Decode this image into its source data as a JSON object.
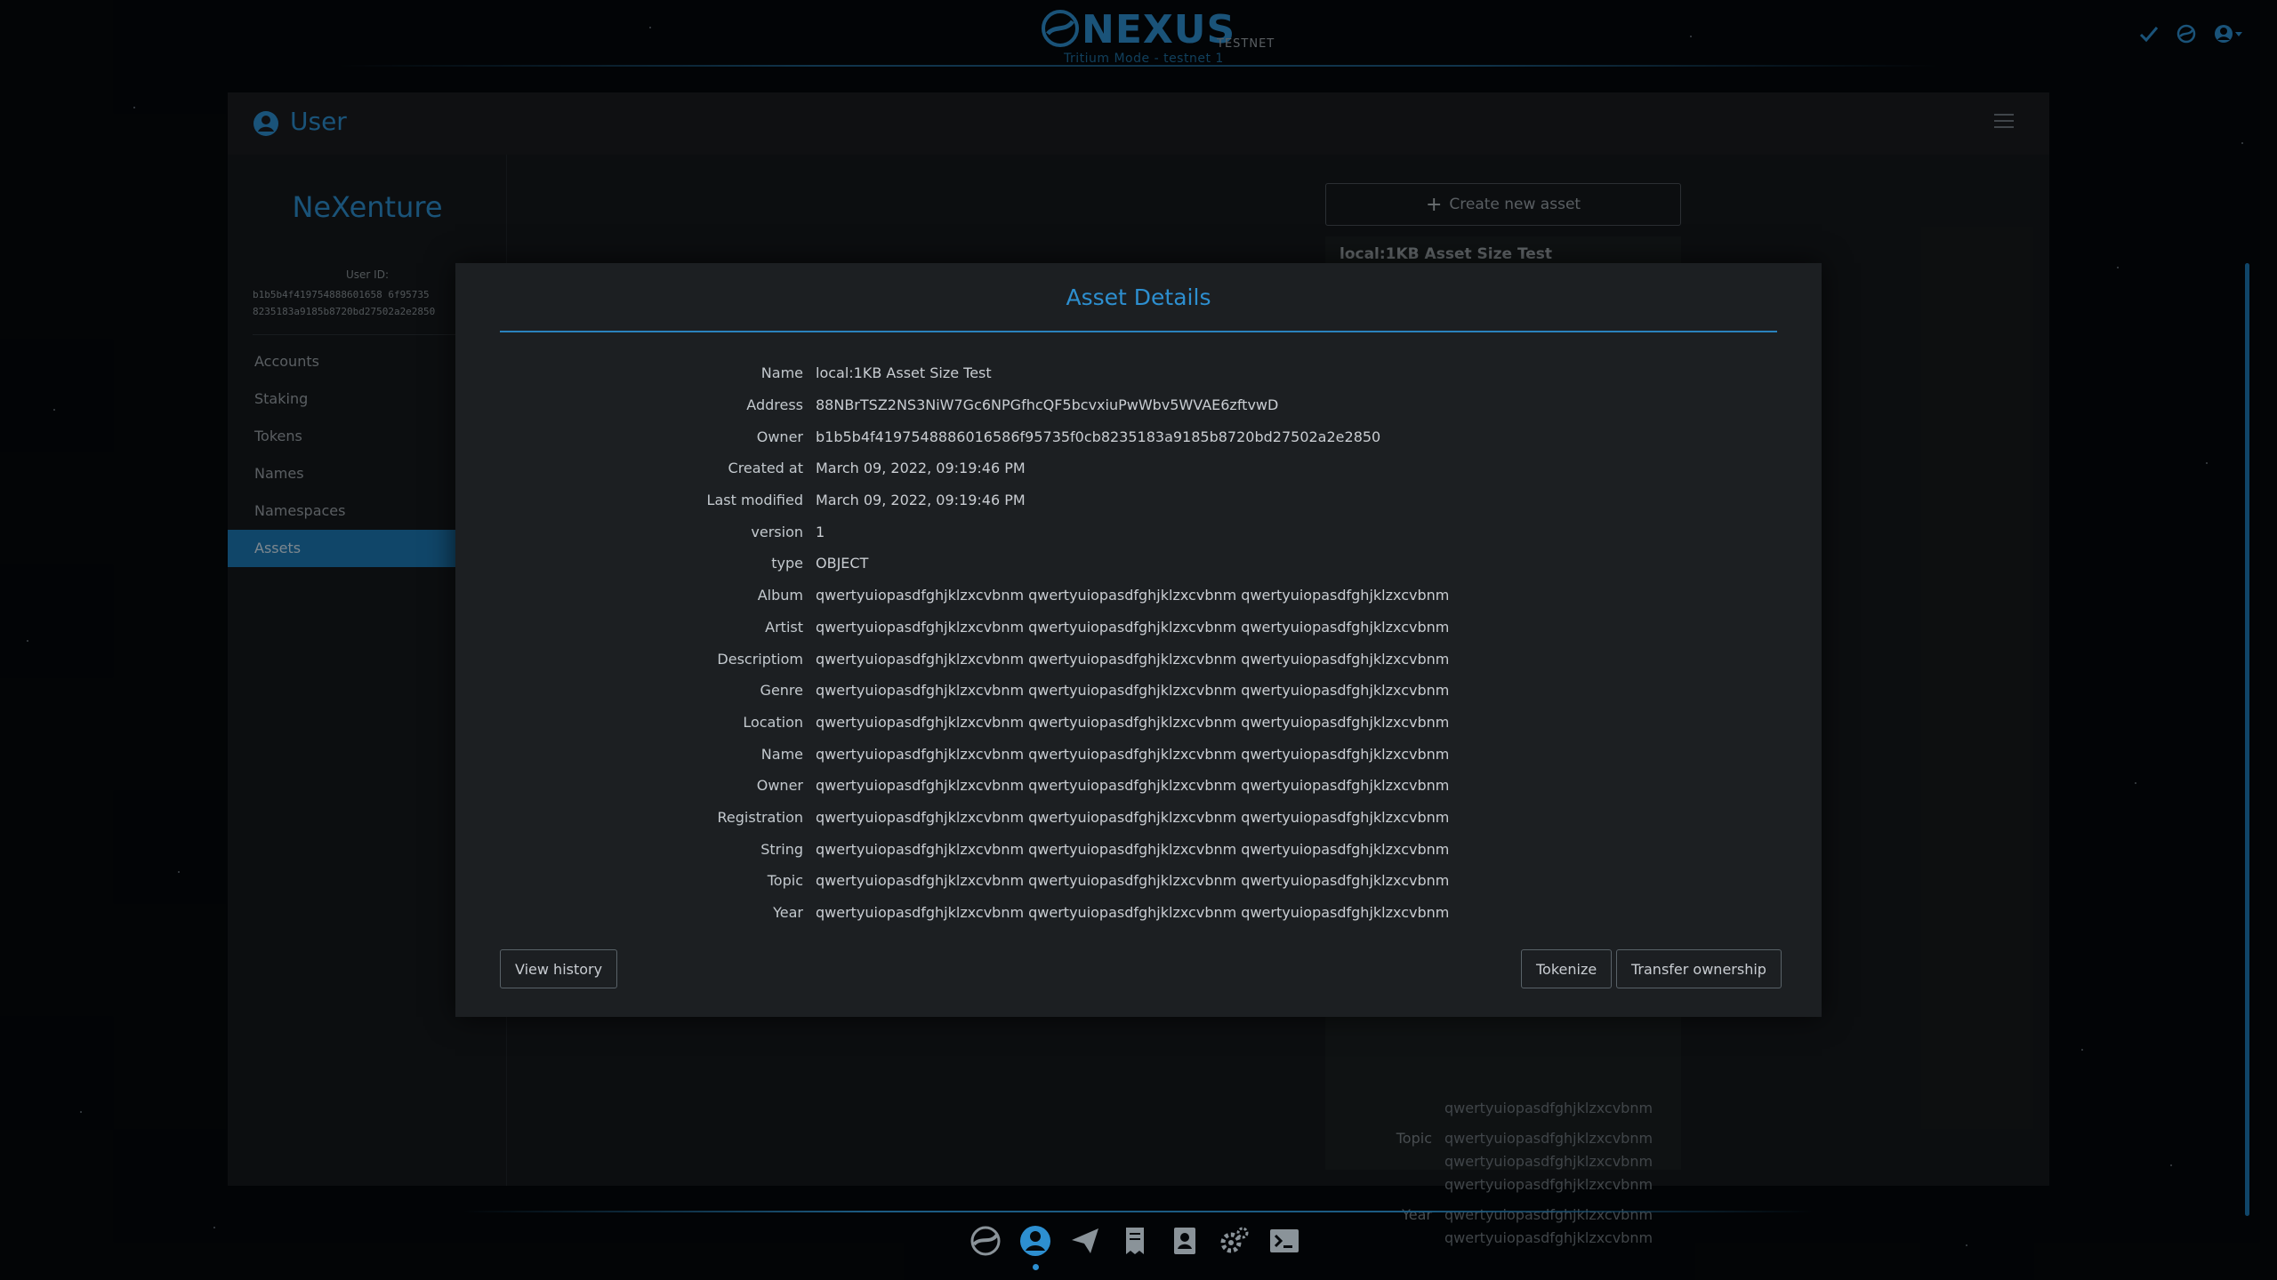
{
  "app": {
    "logo_text": "NEXUS",
    "logo_network": "TESTNET",
    "logo_subtitle": "Tritium Mode - testnet 1"
  },
  "header_icons": [
    "check-icon",
    "sync-icon",
    "user-menu-icon"
  ],
  "page": {
    "title": "User",
    "username": "NeXenture",
    "user_id_label": "User ID:",
    "user_id_line1": "b1b5b4f419754888601658 6f95735",
    "user_id_line2": "8235183a9185b8720bd27502a2e2850"
  },
  "sidebar": {
    "items": [
      {
        "label": "Accounts",
        "active": false
      },
      {
        "label": "Staking",
        "active": false
      },
      {
        "label": "Tokens",
        "active": false
      },
      {
        "label": "Names",
        "active": false
      },
      {
        "label": "Namespaces",
        "active": false
      },
      {
        "label": "Assets",
        "active": true
      }
    ]
  },
  "assets_list": {
    "create_label": "Create new asset",
    "card_title": "local:1KB Asset Size Test",
    "bg_rows": [
      {
        "key": "",
        "value": "qwertyuiopasdfghjklzxcvbnm"
      },
      {
        "key": "Topic",
        "value": "qwertyuiopasdfghjklzxcvbnm"
      },
      {
        "key": "",
        "value": "qwertyuiopasdfghjklzxcvbnm"
      },
      {
        "key": "",
        "value": "qwertyuiopasdfghjklzxcvbnm"
      },
      {
        "key": "Year",
        "value": "qwertyuiopasdfghjklzxcvbnm"
      },
      {
        "key": "",
        "value": "qwertyuiopasdfghjklzxcvbnm"
      }
    ]
  },
  "modal": {
    "title": "Asset Details",
    "fields": [
      {
        "label": "Name",
        "value": "local:1KB Asset Size Test"
      },
      {
        "label": "Address",
        "value": "88NBrTSZ2NS3NiW7Gc6NPGfhcQF5bcvxiuPwWbv5WVAE6zftvwD"
      },
      {
        "label": "Owner",
        "value": "b1b5b4f4197548886016586f95735f0cb8235183a9185b8720bd27502a2e2850"
      },
      {
        "label": "Created at",
        "value": "March 09, 2022, 09:19:46 PM"
      },
      {
        "label": "Last modified",
        "value": "March 09, 2022, 09:19:46 PM"
      },
      {
        "label": "version",
        "value": "1"
      },
      {
        "label": "type",
        "value": "OBJECT"
      },
      {
        "label": "Album",
        "value": "qwertyuiopasdfghjklzxcvbnm qwertyuiopasdfghjklzxcvbnm qwertyuiopasdfghjklzxcvbnm"
      },
      {
        "label": "Artist",
        "value": "qwertyuiopasdfghjklzxcvbnm qwertyuiopasdfghjklzxcvbnm qwertyuiopasdfghjklzxcvbnm"
      },
      {
        "label": "Descriptiom",
        "value": "qwertyuiopasdfghjklzxcvbnm qwertyuiopasdfghjklzxcvbnm qwertyuiopasdfghjklzxcvbnm"
      },
      {
        "label": "Genre",
        "value": "qwertyuiopasdfghjklzxcvbnm qwertyuiopasdfghjklzxcvbnm qwertyuiopasdfghjklzxcvbnm"
      },
      {
        "label": "Location",
        "value": "qwertyuiopasdfghjklzxcvbnm qwertyuiopasdfghjklzxcvbnm qwertyuiopasdfghjklzxcvbnm"
      },
      {
        "label": "Name",
        "value": "qwertyuiopasdfghjklzxcvbnm qwertyuiopasdfghjklzxcvbnm qwertyuiopasdfghjklzxcvbnm"
      },
      {
        "label": "Owner",
        "value": "qwertyuiopasdfghjklzxcvbnm qwertyuiopasdfghjklzxcvbnm qwertyuiopasdfghjklzxcvbnm"
      },
      {
        "label": "Registration",
        "value": "qwertyuiopasdfghjklzxcvbnm qwertyuiopasdfghjklzxcvbnm qwertyuiopasdfghjklzxcvbnm"
      },
      {
        "label": "String",
        "value": "qwertyuiopasdfghjklzxcvbnm qwertyuiopasdfghjklzxcvbnm qwertyuiopasdfghjklzxcvbnm"
      },
      {
        "label": "Topic",
        "value": "qwertyuiopasdfghjklzxcvbnm qwertyuiopasdfghjklzxcvbnm qwertyuiopasdfghjklzxcvbnm"
      },
      {
        "label": "Year",
        "value": "qwertyuiopasdfghjklzxcvbnm qwertyuiopasdfghjklzxcvbnm qwertyuiopasdfghjklzxcvbnm"
      }
    ],
    "view_history_label": "View history",
    "tokenize_label": "Tokenize",
    "transfer_label": "Transfer ownership"
  },
  "bottom_nav": {
    "items": [
      "overview-icon",
      "user-icon",
      "send-icon",
      "transactions-icon",
      "address-book-icon",
      "settings-icon",
      "console-icon"
    ],
    "active": "user-icon"
  },
  "colors": {
    "accent": "#2d8fd0",
    "active_item": "#1d79b6",
    "modal_bg": "#1c1f22",
    "panel_bg": "#16191c"
  }
}
